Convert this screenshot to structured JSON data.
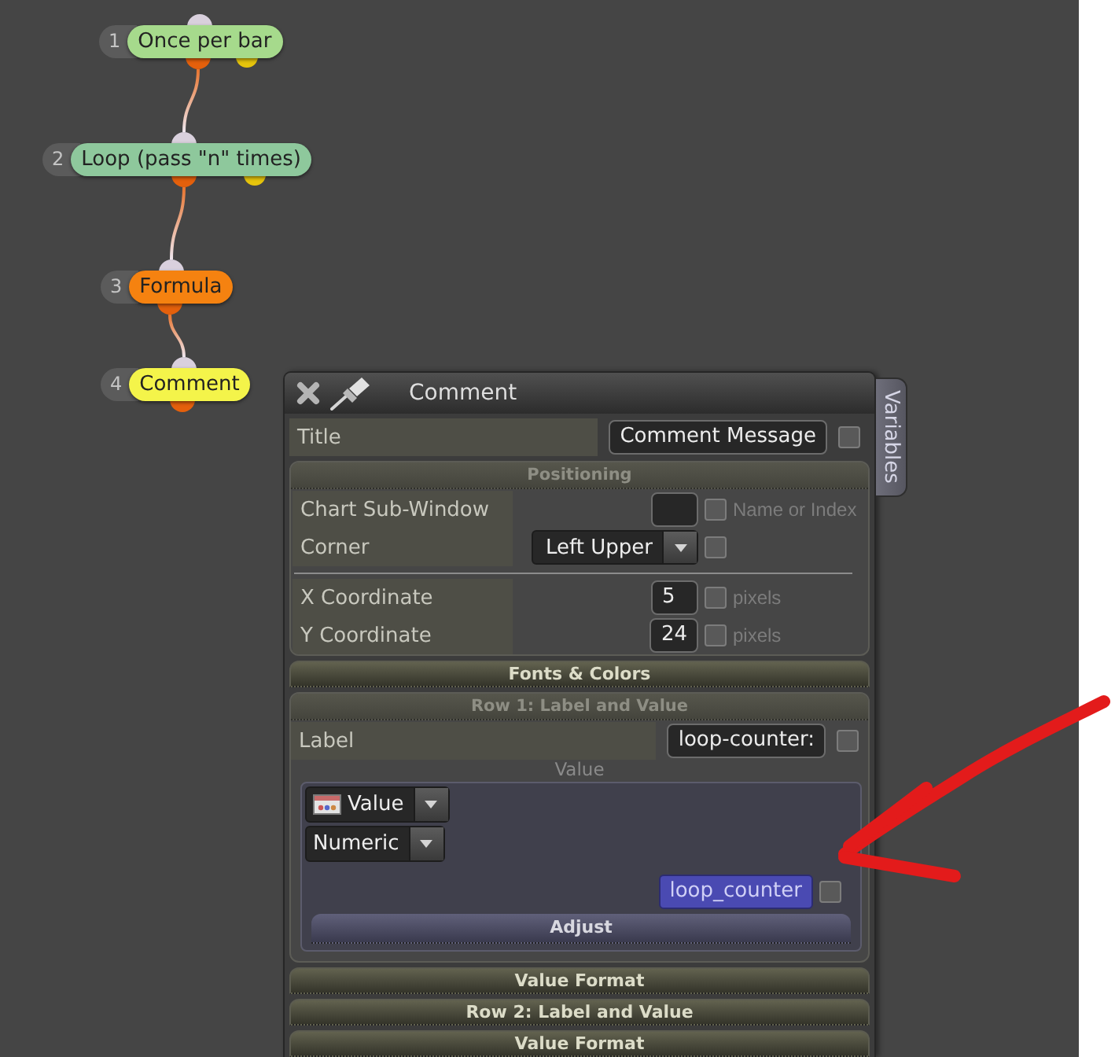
{
  "nodes": [
    {
      "number": "1",
      "label": "Once per bar",
      "color": "#a6da8c",
      "extra_output": true
    },
    {
      "number": "2",
      "label": "Loop (pass \"n\" times)",
      "color": "#8ec89c",
      "extra_output": true
    },
    {
      "number": "3",
      "label": "Formula",
      "color": "#f58210",
      "extra_output": false
    },
    {
      "number": "4",
      "label": "Comment",
      "color": "#f4f44a",
      "extra_output": false
    }
  ],
  "dialog": {
    "title": "Comment",
    "side_tab": "Variables",
    "title_row": {
      "label": "Title",
      "value": "Comment Message",
      "checked": false
    },
    "sections": [
      {
        "title": "Positioning",
        "expanded": true,
        "rows": [
          {
            "kind": "short",
            "label": "Chart Sub-Window",
            "checked": false,
            "note": "Name or Index"
          },
          {
            "kind": "choice",
            "label": "Corner",
            "value": "Left Upper",
            "checked": false
          },
          {
            "kind": "divider"
          },
          {
            "kind": "short",
            "label": "X Coordinate",
            "value": "5",
            "checked": false,
            "note": "pixels"
          },
          {
            "kind": "short",
            "label": "Y Coordinate",
            "value": "24",
            "checked": false,
            "note": "pixels"
          }
        ]
      },
      {
        "title": "Fonts & Colors",
        "expanded": false
      },
      {
        "title": "Row 1: Label and Value",
        "expanded": true,
        "rows": [
          {
            "kind": "long",
            "label": "Label",
            "value": "loop-counter:",
            "checked": false
          }
        ],
        "subheading": "Value",
        "value_panel": {
          "source": "Value",
          "type": "Numeric",
          "variable": "loop_counter",
          "checked": false,
          "adjust": {
            "title": "Adjust",
            "expanded": false
          }
        }
      },
      {
        "title": "Value Format",
        "expanded": false
      },
      {
        "title": "Row 2: Label and Value",
        "expanded": false
      },
      {
        "title": "Value Format",
        "expanded": false
      }
    ]
  }
}
